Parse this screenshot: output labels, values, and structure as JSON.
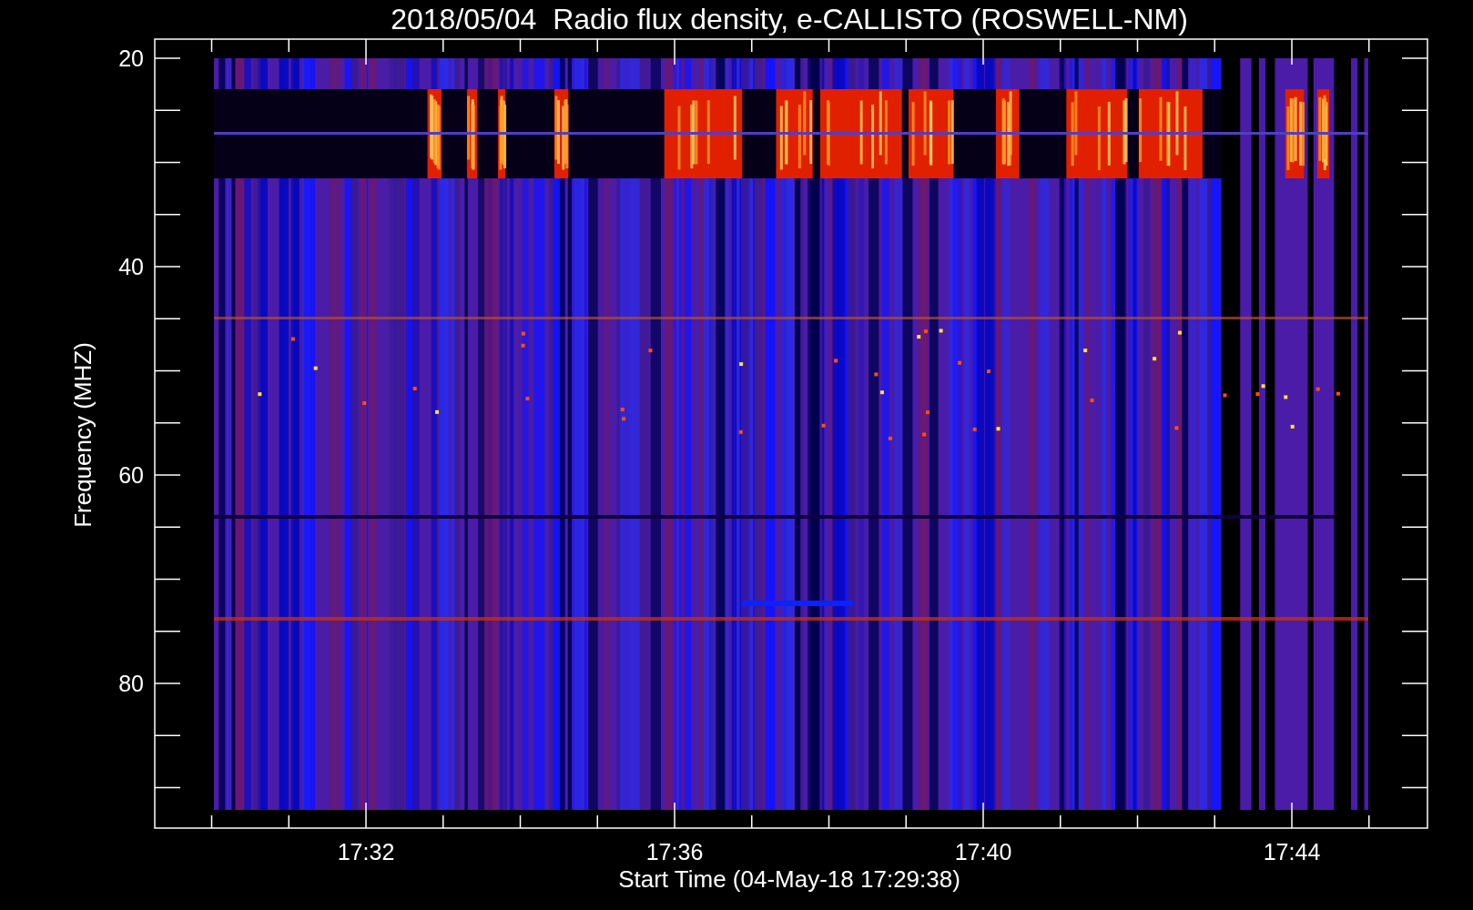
{
  "title": "2018/05/04  Radio flux density, e-CALLISTO (ROSWELL-NM)",
  "plot": {
    "kind": "spectrogram",
    "y_axis": {
      "label": "Frequency (MHZ)",
      "ticks": [
        "20",
        "40",
        "60",
        "80"
      ]
    },
    "x_axis": {
      "label": "Start Time (04-May-18 17:29:38)",
      "ticks": [
        "17:32",
        "17:36",
        "17:40",
        "17:44"
      ]
    }
  }
}
